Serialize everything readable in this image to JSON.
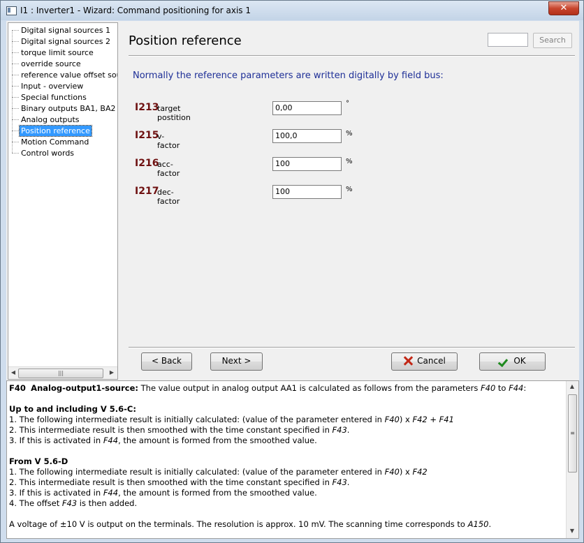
{
  "window": {
    "title": "I1 : Inverter1 - Wizard: Command positioning for axis 1",
    "close_label": "✕"
  },
  "tree": {
    "items": [
      {
        "label": "Digital signal sources 1"
      },
      {
        "label": "Digital signal sources 2"
      },
      {
        "label": "torque limit source"
      },
      {
        "label": "override source"
      },
      {
        "label": "reference value offset source"
      },
      {
        "label": "Input - overview"
      },
      {
        "label": "Special functions"
      },
      {
        "label": "Binary outputs BA1, BA2"
      },
      {
        "label": "Analog outputs"
      },
      {
        "label": "Position reference"
      },
      {
        "label": "Motion Command"
      },
      {
        "label": "Control words"
      }
    ],
    "selected": "Position reference",
    "scroll_left": "◀",
    "scroll_right": "▶",
    "scroll_grip": "|||"
  },
  "page": {
    "title": "Position reference",
    "search_value": "",
    "search_label": "Search",
    "intro": "Normally the reference parameters are written digitally by field bus:",
    "params": [
      {
        "code": "I213",
        "name": "target postition",
        "value": "0,00",
        "unit": "°"
      },
      {
        "code": "I215",
        "name": "v-factor",
        "value": "100,0",
        "unit": "%"
      },
      {
        "code": "I216",
        "name": "acc-factor",
        "value": "100",
        "unit": "%"
      },
      {
        "code": "I217",
        "name": "dec-factor",
        "value": "100",
        "unit": "%"
      }
    ]
  },
  "buttons": {
    "back": "< Back",
    "next": "Next >",
    "cancel": "Cancel",
    "ok": "OK"
  },
  "help": {
    "heading_code": "F40",
    "heading_name": "Analog-output1-source:",
    "heading_text_a": " The value output in analog output AA1 is calculated as follows from the parameters ",
    "heading_ref_a": "F40",
    "heading_text_b": " to ",
    "heading_ref_b": "F44",
    "heading_end": ":",
    "sec1_title": "Up to and including V 5.6-C:",
    "sec1_l1_a": "1. The following intermediate result is initially calculated: (value of the parameter entered in ",
    "sec1_l1_b": "F40",
    "sec1_l1_c": ") x ",
    "sec1_l1_d": "F42 + F41",
    "sec1_l2_a": "2. This intermediate result is then smoothed with the time constant specified in ",
    "sec1_l2_b": "F43",
    "sec1_l2_c": ".",
    "sec1_l3_a": "3. If this is activated in ",
    "sec1_l3_b": "F44",
    "sec1_l3_c": ", the amount is formed from the smoothed value.",
    "sec2_title": "From V 5.6-D",
    "sec2_l1_a": "1. The following intermediate result is initially calculated: (value of the parameter entered in ",
    "sec2_l1_b": "F40",
    "sec2_l1_c": ") x ",
    "sec2_l1_d": "F42",
    "sec2_l2_a": "2. This intermediate result is then smoothed with the time constant specified in ",
    "sec2_l2_b": "F43",
    "sec2_l2_c": ".",
    "sec2_l3_a": "3. If this is activated in ",
    "sec2_l3_b": "F44",
    "sec2_l3_c": ", the amount is formed from the smoothed value.",
    "sec2_l4_a": "4. The offset ",
    "sec2_l4_b": "F43",
    "sec2_l4_c": " is then added.",
    "footer_a": "A voltage of ±10 V is output on the terminals. The resolution is approx. 10 mV. The scanning time corresponds to ",
    "footer_b": "A150",
    "footer_c": ".",
    "scroll_up": "▲",
    "scroll_down": "▼",
    "scroll_grip": "≡"
  }
}
